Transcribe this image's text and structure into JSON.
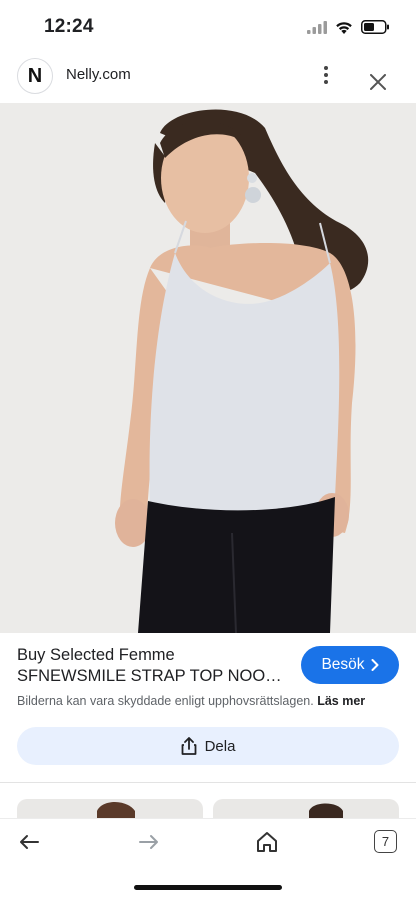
{
  "status_bar": {
    "time": "12:24",
    "icons": [
      "cellular-signal-icon",
      "wifi-icon",
      "battery-icon"
    ]
  },
  "header": {
    "favicon_letter": "N",
    "site_name": "Nelly.com",
    "more_icon": "more-vertical-icon",
    "close_icon": "close-icon"
  },
  "product": {
    "title_line1": "Buy Selected Femme",
    "title_line2": "SFNEWSMILE STRAP TOP NOO…",
    "visit_label": "Besök",
    "visit_icon": "chevron-right-icon",
    "notice_text": "Bilderna kan vara skyddade enligt upphovsrättslagen.",
    "notice_link": "Läs mer",
    "share_label": "Dela",
    "share_icon": "share-icon"
  },
  "bottom_nav": {
    "back_icon": "arrow-left-icon",
    "forward_icon": "arrow-right-icon",
    "home_icon": "home-icon",
    "tab_count": "7"
  },
  "colors": {
    "accent": "#1a73e8",
    "share_bg": "#e8f0fe",
    "hero_bg": "#ecebe9"
  }
}
